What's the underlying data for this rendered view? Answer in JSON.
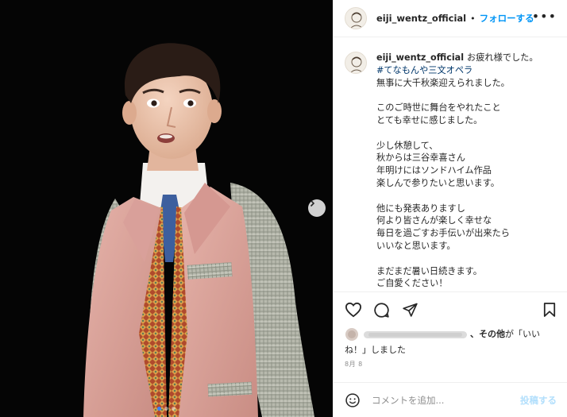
{
  "header": {
    "username": "eiji_wentz_official",
    "separator": "•",
    "follow_label": "フォローする",
    "more_label": "•••"
  },
  "caption": {
    "username": "eiji_wentz_official",
    "first_line": "お疲れ様でした。",
    "hashtag": "#てなもんや三文オペラ",
    "lines": [
      "無事に大千秋楽迎えられました。",
      "",
      "このご時世に舞台をやれたこと",
      "とても幸せに感じました。",
      "",
      "少し休憩して、",
      "秋からは三谷幸喜さん",
      "年明けにはソンドハイム作品",
      "楽しんで参りたいと思います。",
      "",
      "他にも発表ありますし",
      "何より皆さんが楽しく幸せな",
      "毎日を過ごすお手伝いが出来たら",
      "いいなと思います。",
      "",
      "まだまだ暑い日続きます。",
      "ご自愛ください！"
    ]
  },
  "actions": {
    "like_icon": "heart-icon",
    "comment_icon": "comment-bubble-icon",
    "share_icon": "paper-plane-icon",
    "save_icon": "bookmark-icon"
  },
  "likes": {
    "others_label": "、その他",
    "middle": "が「いい",
    "end_line": "ね！」しました"
  },
  "date": "8月 8",
  "comment": {
    "placeholder": "コメントを追加...",
    "post_label": "投稿する",
    "emoji_icon": "smile-icon"
  },
  "carousel": {
    "next_icon": "chevron-right-icon",
    "current_index": 1,
    "total": 3
  },
  "colors": {
    "link_blue": "#0095f6",
    "hashtag_blue": "#00376b",
    "muted_gray": "#8e8e8e",
    "post_disabled": "#b2dffc"
  }
}
